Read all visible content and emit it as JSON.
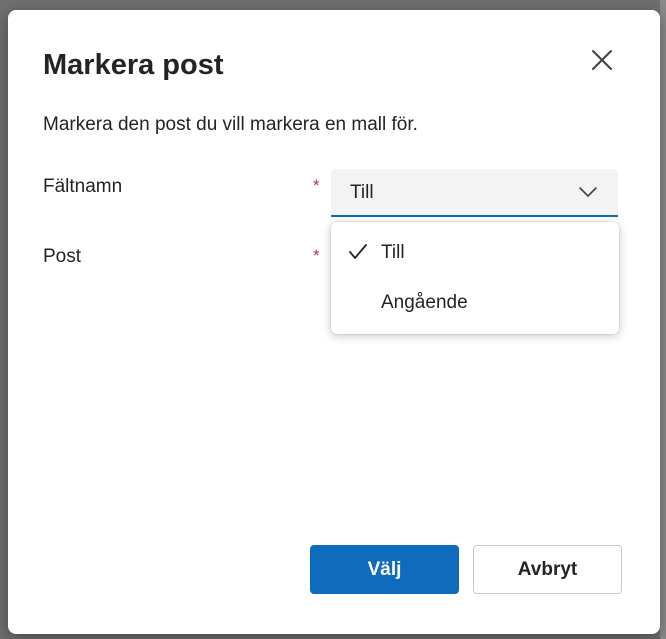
{
  "dialog": {
    "title": "Markera post",
    "description": "Markera den post du vill markera en mall för.",
    "close_icon": "close-icon"
  },
  "fields": {
    "field_name": {
      "label": "Fältnamn",
      "required_marker": "*",
      "selected_value": "Till",
      "chevron_icon": "chevron-down-icon"
    },
    "post": {
      "label": "Post",
      "required_marker": "*"
    }
  },
  "dropdown_options": [
    {
      "label": "Till",
      "selected": true
    },
    {
      "label": "Angående",
      "selected": false
    }
  ],
  "buttons": {
    "primary_label": "Välj",
    "secondary_label": "Avbryt"
  },
  "colors": {
    "accent": "#0f6cbd",
    "required": "#c4314b",
    "text": "#242424"
  }
}
